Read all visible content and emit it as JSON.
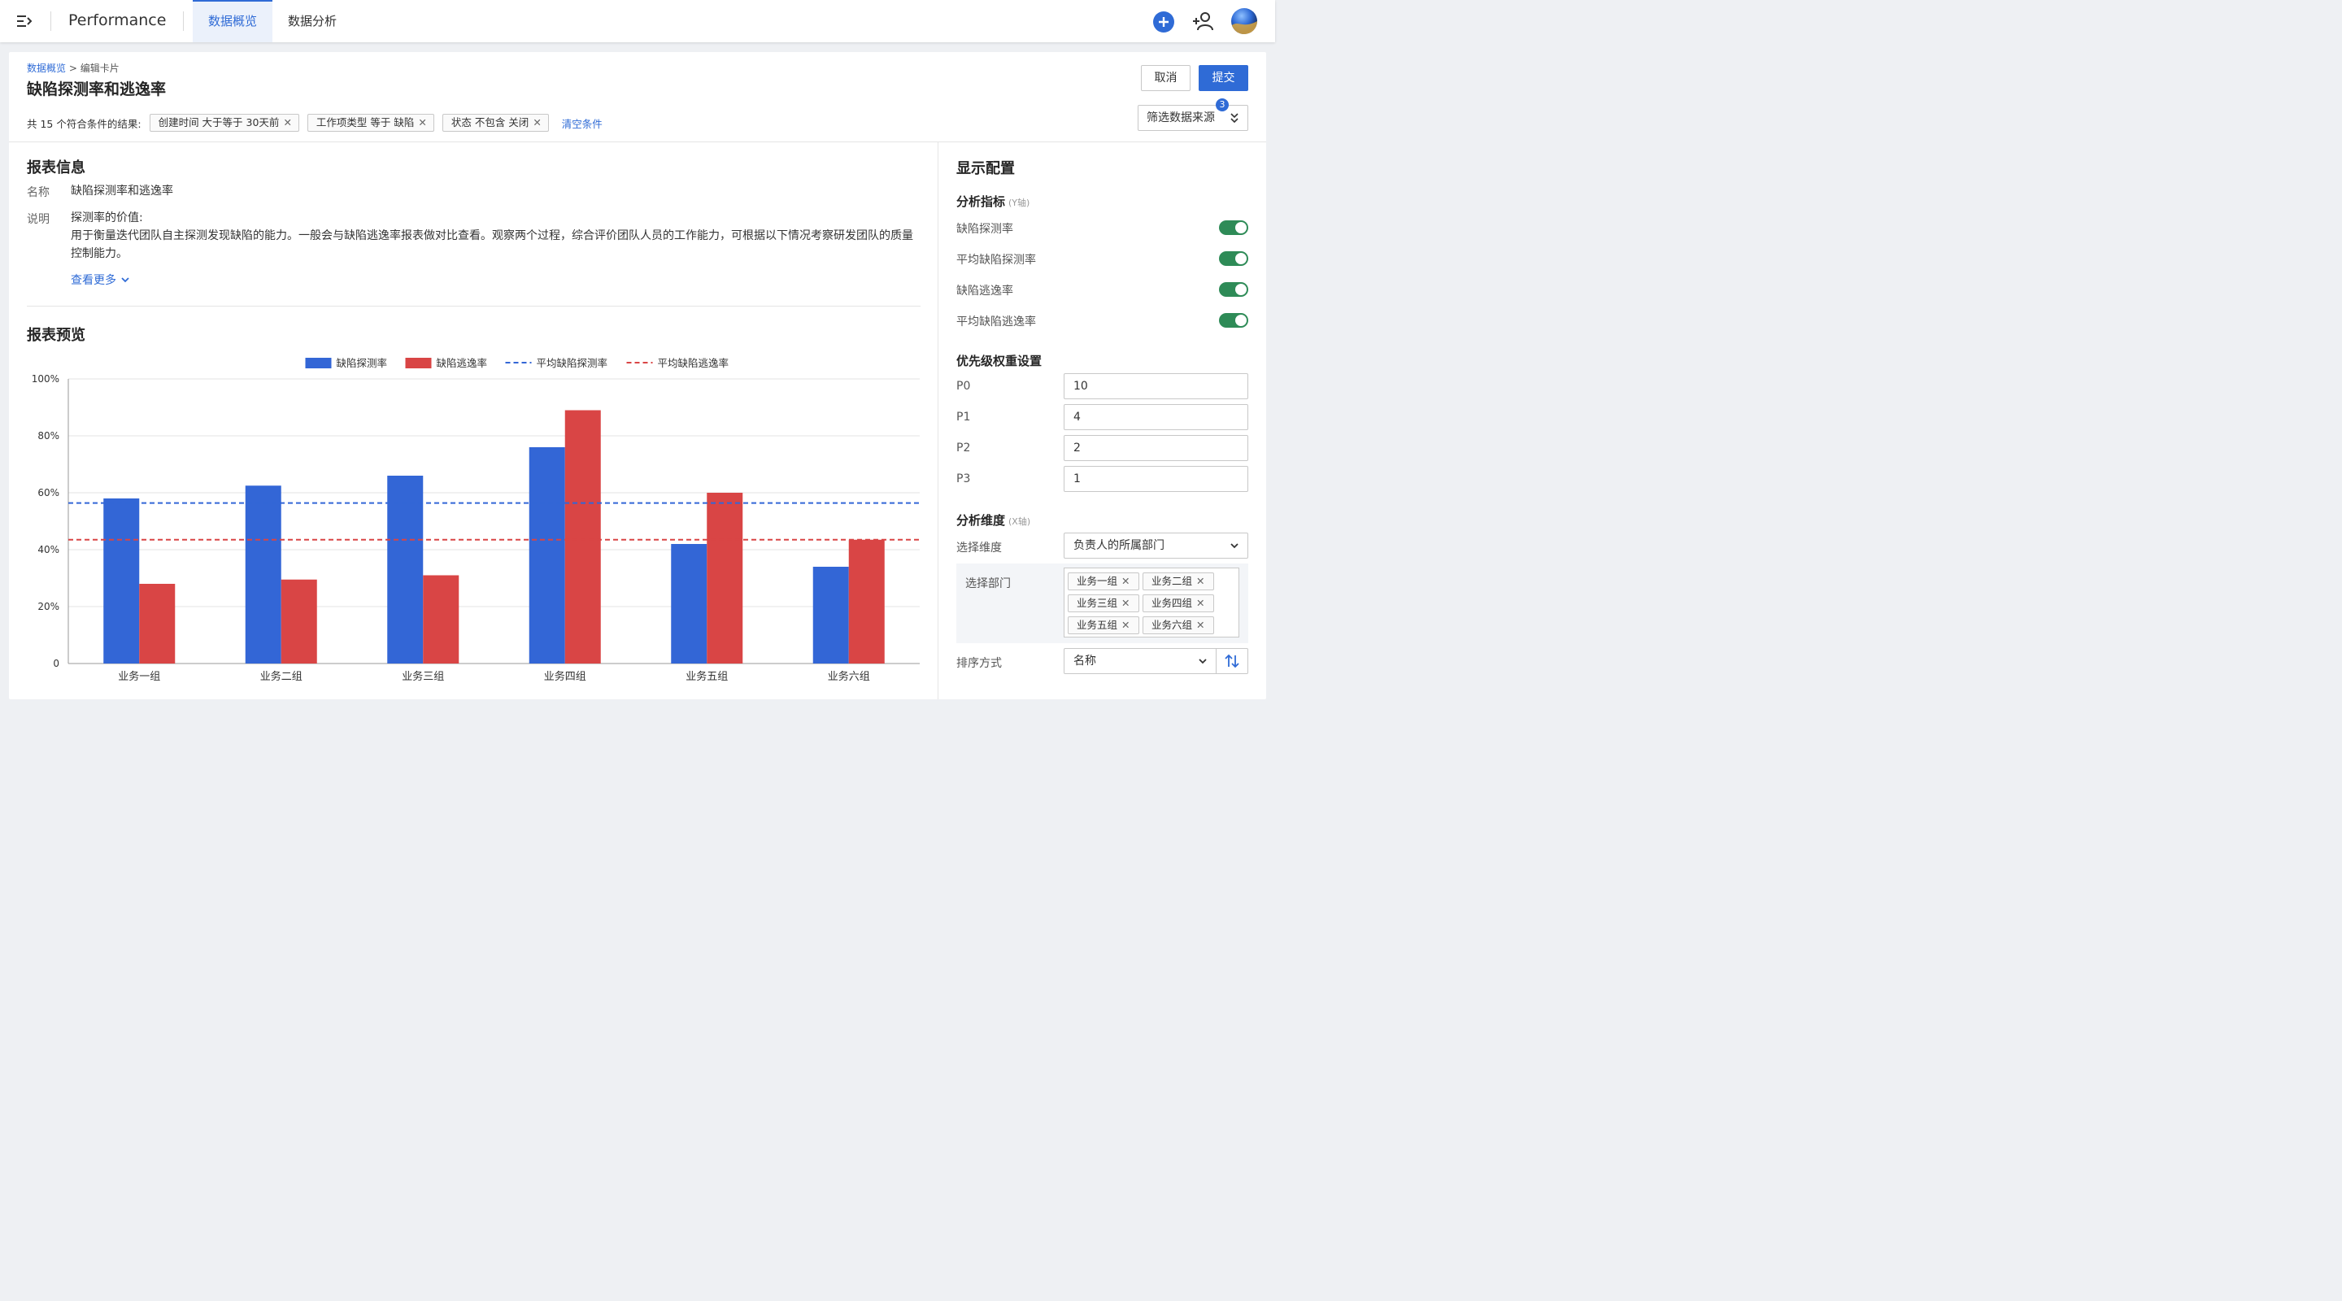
{
  "topbar": {
    "app_title": "Performance",
    "tabs": [
      {
        "label": "数据概览",
        "active": true
      },
      {
        "label": "数据分析",
        "active": false
      }
    ],
    "icons": [
      "menu-toggle-icon",
      "plus-circle-icon",
      "add-user-icon",
      "avatar"
    ]
  },
  "header": {
    "breadcrumb": {
      "parent": "数据概览",
      "separator": ">",
      "current": "编辑卡片"
    },
    "title": "缺陷探测率和逃逸率",
    "cancel_label": "取消",
    "submit_label": "提交",
    "source_label": "筛选数据来源",
    "source_badge": "3"
  },
  "filters": {
    "result_text": "共 15 个符合条件的结果:",
    "chips": [
      "创建时间 大于等于 30天前",
      "工作项类型 等于 缺陷",
      "状态 不包含 关闭"
    ],
    "clear_label": "清空条件"
  },
  "report_info": {
    "title": "报表信息",
    "name_label": "名称",
    "name_value": "缺陷探测率和逃逸率",
    "desc_label": "说明",
    "desc_line1": "探测率的价值:",
    "desc_line2": "用于衡量迭代团队自主探测发现缺陷的能力。一般会与缺陷逃逸率报表做对比查看。观察两个过程，综合评价团队人员的工作能力，可根据以下情况考察研发团队的质量控制能力。",
    "more_label": "查看更多"
  },
  "preview": {
    "title": "报表预览"
  },
  "chart_data": {
    "type": "bar",
    "categories": [
      "业务一组",
      "业务二组",
      "业务三组",
      "业务四组",
      "业务五组",
      "业务六组"
    ],
    "series": [
      {
        "name": "缺陷探测率",
        "values": [
          58,
          62.5,
          66,
          76,
          42,
          34
        ],
        "color": "#3366d6"
      },
      {
        "name": "缺陷逃逸率",
        "values": [
          28,
          29.5,
          31,
          89,
          60,
          43.5
        ],
        "color": "#d94545"
      }
    ],
    "reference_lines": [
      {
        "name": "平均缺陷探测率",
        "value": 56.4,
        "color": "#3366d6",
        "style": "dashed"
      },
      {
        "name": "平均缺陷逃逸率",
        "value": 43.5,
        "color": "#d94545",
        "style": "dashed"
      }
    ],
    "y_ticks": [
      "0",
      "20%",
      "40%",
      "60%",
      "80%",
      "100%"
    ],
    "ylim": [
      0,
      100
    ],
    "grid": true,
    "legend_position": "top-center"
  },
  "display_config": {
    "title": "显示配置",
    "metrics_title": "分析指标",
    "metrics_hint": "(Y轴)",
    "metrics": [
      {
        "label": "缺陷探测率",
        "on": true
      },
      {
        "label": "平均缺陷探测率",
        "on": true
      },
      {
        "label": "缺陷逃逸率",
        "on": true
      },
      {
        "label": "平均缺陷逃逸率",
        "on": true
      }
    ],
    "priority_title": "优先级权重设置",
    "priorities": [
      {
        "label": "P0",
        "value": "10"
      },
      {
        "label": "P1",
        "value": "4"
      },
      {
        "label": "P2",
        "value": "2"
      },
      {
        "label": "P3",
        "value": "1"
      }
    ],
    "dimension_title": "分析维度",
    "dimension_hint": "(X轴)",
    "dimension_label": "选择维度",
    "dimension_value": "负责人的所属部门",
    "dept_label": "选择部门",
    "depts": [
      "业务一组",
      "业务二组",
      "业务三组",
      "业务四组",
      "业务五组",
      "业务六组"
    ],
    "sort_label": "排序方式",
    "sort_value": "名称"
  }
}
